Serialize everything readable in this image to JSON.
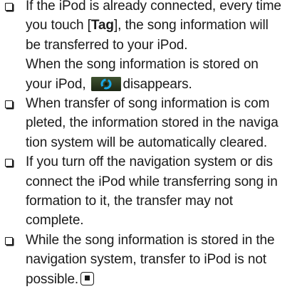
{
  "bullets": [
    {
      "segments": [
        "If the iPod is already connected, every time",
        "you touch [",
        "Tag",
        "], the song information will",
        "be transferred to your iPod.",
        "When the song information is stored on",
        "your iPod,",
        "disappears."
      ],
      "icon": "ipod-transfer-icon"
    },
    {
      "lines": [
        "When transfer of song information is com",
        "pleted, the information stored in the naviga",
        "tion system will be automatically cleared."
      ]
    },
    {
      "lines": [
        "If you turn off the navigation system or dis",
        "connect the iPod while transferring song in",
        "formation to it, the transfer may not",
        "complete."
      ]
    },
    {
      "lines": [
        "While the song information is stored in the",
        "navigation system, transfer to iPod is not",
        "possible."
      ],
      "end_mark": "end-of-section-icon"
    }
  ],
  "colors": {
    "text": "#1a1a1a",
    "icon_dark": "#2a3a1e",
    "icon_accent": "#18a8e8"
  }
}
